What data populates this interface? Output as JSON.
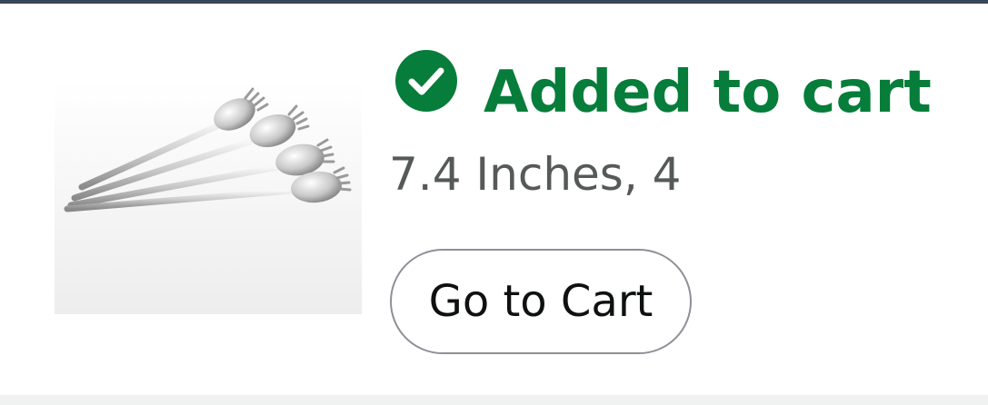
{
  "confirmation": {
    "status_label": "Added to cart",
    "status_icon": "checkmark-circle-icon",
    "status_color": "#067d3a"
  },
  "product": {
    "variant_text": "7.4 Inches, 4",
    "image_icon": "spork-set-product-image"
  },
  "actions": {
    "go_to_cart_label": "Go to Cart"
  },
  "colors": {
    "top_bar": "#37475a",
    "secondary_text": "#565959",
    "button_border": "#8d9096"
  }
}
